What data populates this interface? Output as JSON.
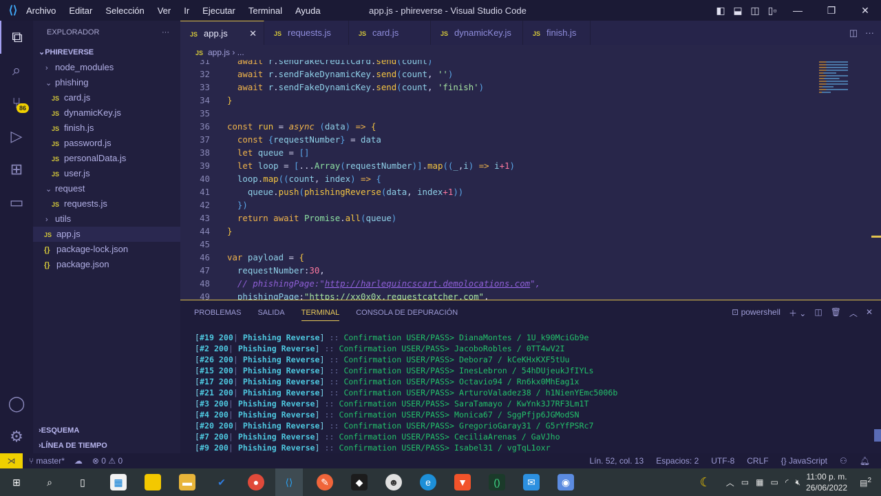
{
  "titlebar": {
    "menu": [
      "Archivo",
      "Editar",
      "Selección",
      "Ver",
      "Ir",
      "Ejecutar",
      "Terminal",
      "Ayuda"
    ],
    "title": "app.js - phireverse - Visual Studio Code"
  },
  "activity": {
    "scm_badge": "86"
  },
  "sidebar": {
    "header": "EXPLORADOR",
    "more": "···",
    "root": "PHIREVERSE",
    "tree": [
      {
        "label": "node_modules",
        "type": "folder",
        "open": false,
        "depth": 1
      },
      {
        "label": "phishing",
        "type": "folder",
        "open": true,
        "depth": 1
      },
      {
        "label": "card.js",
        "type": "js",
        "depth": 2
      },
      {
        "label": "dynamicKey.js",
        "type": "js",
        "depth": 2
      },
      {
        "label": "finish.js",
        "type": "js",
        "depth": 2
      },
      {
        "label": "password.js",
        "type": "js",
        "depth": 2
      },
      {
        "label": "personalData.js",
        "type": "js",
        "depth": 2
      },
      {
        "label": "user.js",
        "type": "js",
        "depth": 2
      },
      {
        "label": "request",
        "type": "folder",
        "open": true,
        "depth": 1
      },
      {
        "label": "requests.js",
        "type": "js",
        "depth": 2
      },
      {
        "label": "utils",
        "type": "folder",
        "open": false,
        "depth": 1
      },
      {
        "label": "app.js",
        "type": "js",
        "depth": 1,
        "selected": true
      },
      {
        "label": "package-lock.json",
        "type": "json",
        "depth": 1
      },
      {
        "label": "package.json",
        "type": "json",
        "depth": 1
      }
    ],
    "outline": "ESQUEMA",
    "timeline": "LÍNEA DE TIEMPO"
  },
  "tabs": [
    {
      "label": "app.js",
      "active": true
    },
    {
      "label": "requests.js"
    },
    {
      "label": "card.js"
    },
    {
      "label": "dynamicKey.js"
    },
    {
      "label": "finish.js"
    }
  ],
  "breadcrumb": {
    "file": "app.js",
    "rest": "..."
  },
  "editor": {
    "lines": [
      {
        "n": "31",
        "html": "  <span class='kw'>await</span> <span class='va'>r</span>.<span class='va'>sendFakeCreditCard</span>.<span class='fn'>send</span><span class='pu'>(</span><span class='va'>count</span><span class='pu'>)</span>"
      },
      {
        "n": "32",
        "html": "  <span class='kw'>await</span> <span class='va'>r</span>.<span class='va'>sendFakeDynamicKey</span>.<span class='fn'>send</span><span class='pu'>(</span><span class='va'>count</span>, <span class='st'>''</span><span class='pu'>)</span>"
      },
      {
        "n": "33",
        "html": "  <span class='kw'>await</span> <span class='va'>r</span>.<span class='va'>sendFakeDynamicKey</span>.<span class='fn'>send</span><span class='pu'>(</span><span class='va'>count</span>, <span class='st'>'finish'</span><span class='pu'>)</span>"
      },
      {
        "n": "34",
        "html": "<span class='fn'>}</span>"
      },
      {
        "n": "35",
        "html": ""
      },
      {
        "n": "36",
        "html": "<span class='kw'>const</span> <span class='fn'>run</span> = <span class='it'>async</span> <span class='pu'>(</span><span class='va'>data</span><span class='pu'>)</span> <span class='kw'>=&gt;</span> <span class='fn'>{</span>"
      },
      {
        "n": "37",
        "html": "  <span class='kw'>const</span> <span class='pu'>{</span><span class='va'>requestNumber</span><span class='pu'>}</span> = <span class='va'>data</span>"
      },
      {
        "n": "38",
        "html": "  <span class='kw'>let</span> <span class='va'>queue</span> = <span class='pu'>[]</span>"
      },
      {
        "n": "39",
        "html": "  <span class='kw'>let</span> <span class='va'>loop</span> = <span class='pu'>[</span>...<span class='cls'>Array</span><span class='pu'>(</span><span class='va'>requestNumber</span><span class='pu'>)</span><span class='pu'>]</span>.<span class='fn'>map</span><span class='pu'>((</span><span class='va'>_</span>,<span class='va'>i</span><span class='pu'>)</span> <span class='kw'>=&gt;</span> <span class='va'>i</span><span class='nu'>+1</span><span class='pu'>)</span>"
      },
      {
        "n": "40",
        "html": "  <span class='va'>loop</span>.<span class='fn'>map</span><span class='pu'>((</span><span class='va'>count</span>, <span class='va'>index</span><span class='pu'>)</span> <span class='kw'>=&gt;</span> <span class='pu'>{</span>"
      },
      {
        "n": "41",
        "html": "    <span class='va'>queue</span>.<span class='fn'>push</span><span class='pu'>(</span><span class='fn'>phishingReverse</span><span class='pu'>(</span><span class='va'>data</span>, <span class='va'>index</span><span class='nu'>+1</span><span class='pu'>))</span>"
      },
      {
        "n": "42",
        "html": "  <span class='pu'>})</span>"
      },
      {
        "n": "43",
        "html": "  <span class='kw'>return</span> <span class='kw'>await</span> <span class='cls'>Promise</span>.<span class='fn'>all</span><span class='pu'>(</span><span class='va'>queue</span><span class='pu'>)</span>"
      },
      {
        "n": "44",
        "html": "<span class='fn'>}</span>"
      },
      {
        "n": "45",
        "html": ""
      },
      {
        "n": "46",
        "html": "<span class='kw'>var</span> <span class='va'>payload</span> = <span class='fn'>{</span>"
      },
      {
        "n": "47",
        "html": "  <span class='va'>requestNumber</span>:<span class='nu'>30</span>,"
      },
      {
        "n": "48",
        "html": "  <span class='cm'>// phishingPage:\"<u>http://harlequincscart.demolocations.com</u>\",</span>"
      },
      {
        "n": "49",
        "html": "  <span class='va'>phishingPage</span>:<span class='st'>\"https://xx0x0x.requestcatcher.com\"</span>,"
      }
    ]
  },
  "panel": {
    "tabs": [
      "PROBLEMAS",
      "SALIDA",
      "TERMINAL",
      "CONSOLA DE DEPURACIÓN"
    ],
    "active_tab": "TERMINAL",
    "shell": "powershell",
    "terminal_lines": [
      {
        "id": "#19",
        "status": "200",
        "tag": "Phishing Reverse",
        "msg": "Confirmation USER/PASS>",
        "cred": "DianaMontes / 1U_k90MciGb9e"
      },
      {
        "id": "#2",
        "status": "200",
        "tag": "Phishing Reverse",
        "msg": "Confirmation USER/PASS>",
        "cred": "JacoboRobles / 0TT4wV2I"
      },
      {
        "id": "#26",
        "status": "200",
        "tag": "Phishing Reverse",
        "msg": "Confirmation USER/PASS>",
        "cred": "Debora7 / kCeKHxKXF5tUu"
      },
      {
        "id": "#15",
        "status": "200",
        "tag": "Phishing Reverse",
        "msg": "Confirmation USER/PASS>",
        "cred": "InesLebron / 54hDUjeukJfIYLs"
      },
      {
        "id": "#17",
        "status": "200",
        "tag": "Phishing Reverse",
        "msg": "Confirmation USER/PASS>",
        "cred": "Octavio94 / Rn6kx0MhEag1x"
      },
      {
        "id": "#21",
        "status": "200",
        "tag": "Phishing Reverse",
        "msg": "Confirmation USER/PASS>",
        "cred": "ArturoValadez38 / h1NienYEmc5006b"
      },
      {
        "id": "#3",
        "status": "200",
        "tag": "Phishing Reverse",
        "msg": "Confirmation USER/PASS>",
        "cred": "SaraTamayo / KwYnk3J7RF3Lm1T"
      },
      {
        "id": "#4",
        "status": "200",
        "tag": "Phishing Reverse",
        "msg": "Confirmation USER/PASS>",
        "cred": "Monica67 / SggPfjp6JGModSN"
      },
      {
        "id": "#20",
        "status": "200",
        "tag": "Phishing Reverse",
        "msg": "Confirmation USER/PASS>",
        "cred": "GregorioGaray31 / G5rYfPSRc7"
      },
      {
        "id": "#7",
        "status": "200",
        "tag": "Phishing Reverse",
        "msg": "Confirmation USER/PASS>",
        "cred": "CeciliaArenas / GaVJho"
      },
      {
        "id": "#9",
        "status": "200",
        "tag": "Phishing Reverse",
        "msg": "Confirmation USER/PASS>",
        "cred": "Isabel31 / vgTqL1oxr"
      }
    ]
  },
  "status": {
    "branch": "master*",
    "errors": "0",
    "warnings": "0",
    "position": "Lín. 52, col. 13",
    "spaces": "Espacios: 2",
    "encoding": "UTF-8",
    "eol": "CRLF",
    "language": "JavaScript"
  },
  "taskbar": {
    "time": "11:00 p. m.",
    "date": "26/06/2022",
    "notifications": "2"
  },
  "colors": {
    "accent": "#e3c34e",
    "remote": "#f0d000",
    "terminal_ok": "#23c26b",
    "terminal_tag": "#4ec8e0"
  }
}
